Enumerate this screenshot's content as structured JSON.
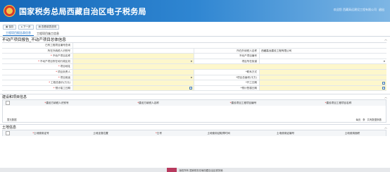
{
  "header": {
    "title": "国家税务总局西藏自治区电子税务局",
    "user_text": "欢迎您 西藏高远建设工程有限公司",
    "logout": "退出"
  },
  "toolbar": {
    "save": "保存",
    "next": "下一步",
    "upload": "查看填表说明"
  },
  "tabs": [
    {
      "label": "工程项目报告表信息"
    },
    {
      "label": "工程项目施工信息"
    }
  ],
  "section": {
    "title": "不动产项目报告_不动产项目总体信息"
  },
  "form": {
    "rows": [
      {
        "l1": "已有工程项目编号查询",
        "v1": "",
        "l2": "",
        "v2": ""
      },
      {
        "l1": "所在外纳税人识别号",
        "v1": "",
        "l2": "所在外纳税人名称",
        "v2": "西藏高远建设工程有限公司"
      },
      {
        "l1": "不动产项目名称",
        "v1": "",
        "l2": "不动产项目编号",
        "v2": ""
      },
      {
        "l1": "不动产项目所在地行政区划",
        "v1": "",
        "l2": "项目所在街道",
        "v2": ""
      },
      {
        "l1": "项目地址",
        "v1": "",
        "l2": "",
        "v2": ""
      },
      {
        "l1": "项目负责人",
        "v1": "",
        "l2": "联系方式",
        "v2": ""
      },
      {
        "l1": "项目用途",
        "v1": "",
        "l2": "项目总面积(平方)",
        "v2": ""
      },
      {
        "l1": "工程总造价(万元)",
        "v1": "",
        "l2": "开工日期",
        "v2": ""
      },
      {
        "l1": "预计竣工日期",
        "v1": "",
        "l2": "预计售楼日期",
        "v2": ""
      }
    ]
  },
  "subsection1": {
    "title": "建设和项目信息",
    "columns": [
      "建设方纳税人识别号",
      "建设方纳税人名称",
      "建设项目工程项目编号",
      "建设项目工程项目名称"
    ],
    "empty_text": "暂无数据",
    "pager_labels": [
      "每页",
      "条",
      "共有数据条数"
    ]
  },
  "subsection2": {
    "title": "土地信息",
    "columns": [
      "土地使用证号",
      "土地坐落位置",
      "丘号",
      "土地使用证取得时间",
      "土地使用证编号",
      "土地使用面积"
    ]
  },
  "footer": {
    "text": "版权所有 国家税务总局西藏自治区税务局"
  }
}
